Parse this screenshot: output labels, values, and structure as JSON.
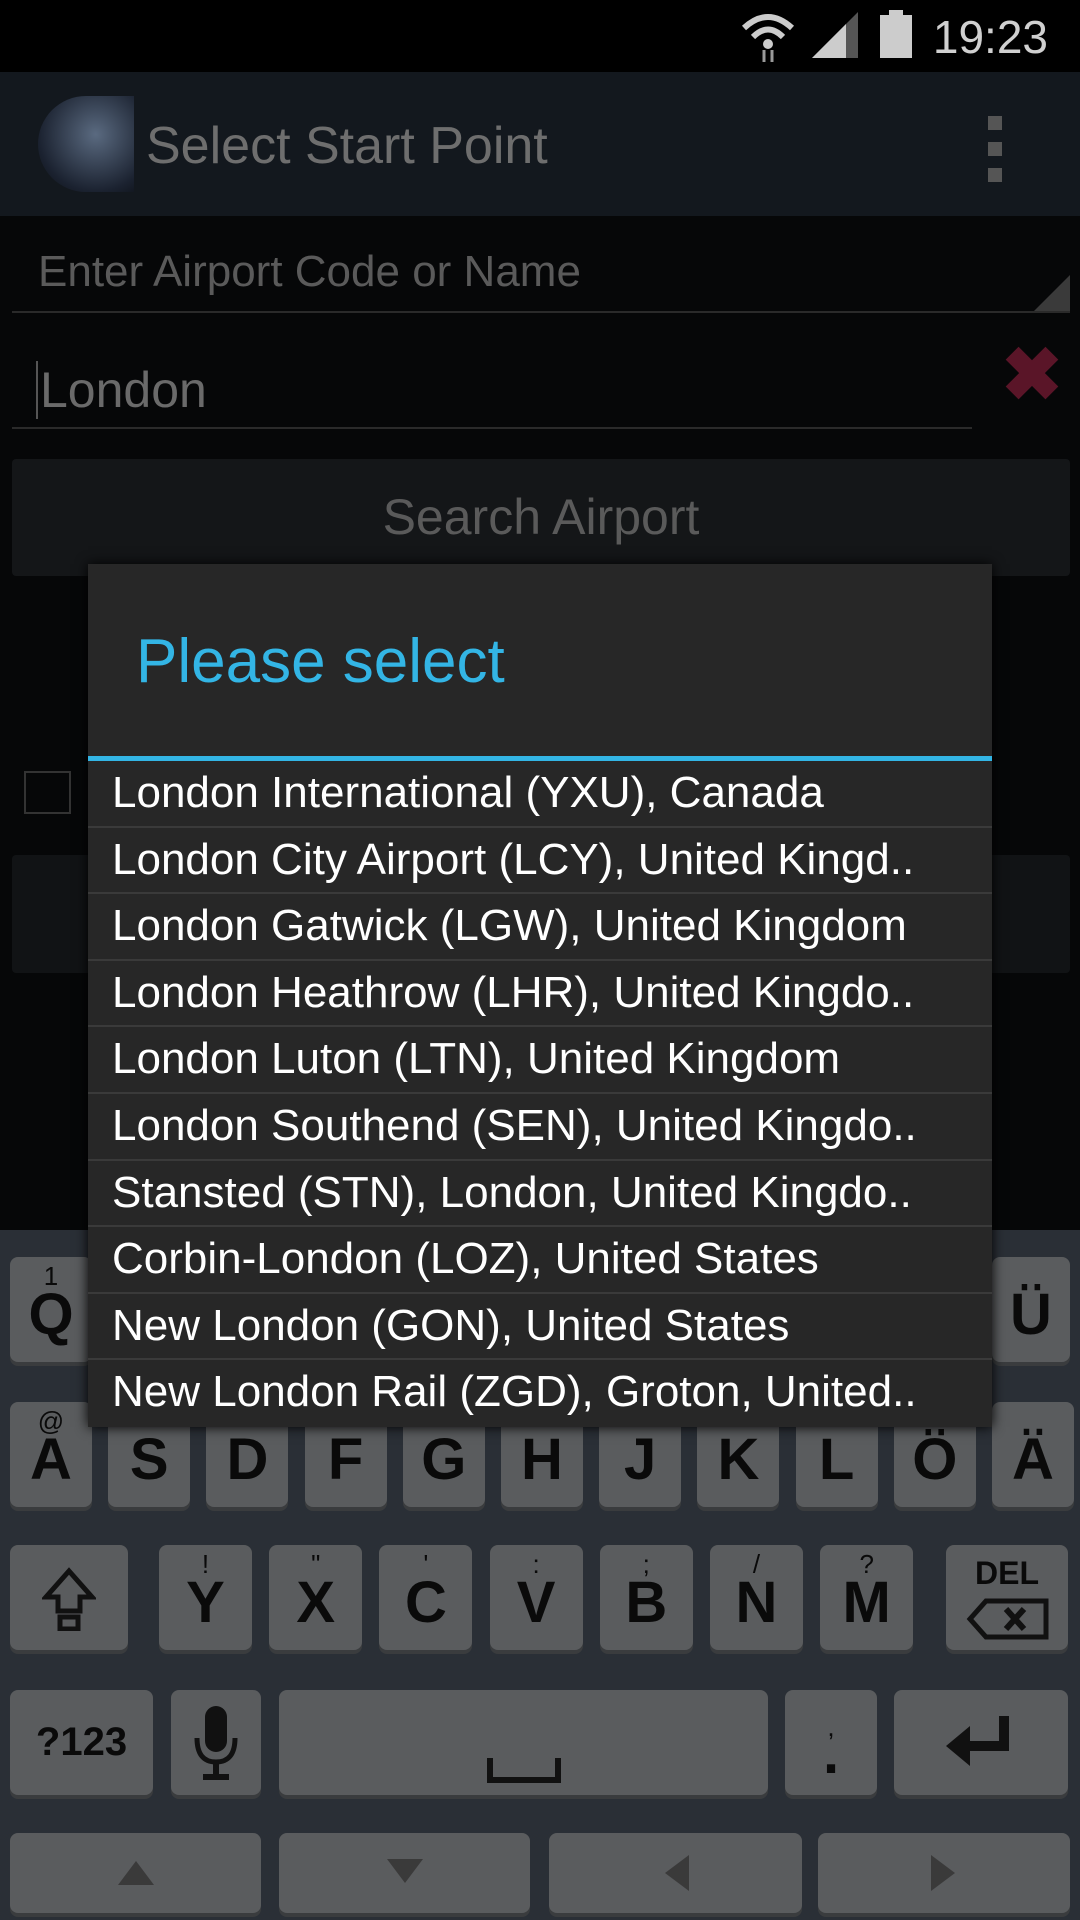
{
  "status_bar": {
    "time": "19:23",
    "icons": [
      "wifi-icon",
      "signal-icon",
      "battery-icon"
    ]
  },
  "action_bar": {
    "title": "Select Start Point",
    "overflow_icon": "more-vertical-icon"
  },
  "form": {
    "code_placeholder": "Enter Airport Code or Name",
    "name_value": "London",
    "clear_icon": "✖",
    "search_label": "Search Airport"
  },
  "dialog": {
    "title": "Please select",
    "accent": "#33B5E5",
    "items": [
      "London International (YXU), Canada",
      "London City Airport (LCY), United Kingd..",
      "London Gatwick (LGW), United Kingdom",
      "London Heathrow (LHR), United Kingdo..",
      "London Luton (LTN), United Kingdom",
      "London Southend (SEN), United Kingdo..",
      "Stansted (STN), London, United Kingdo..",
      "Corbin-London (LOZ), United States",
      "New London (GON), United States",
      "New London Rail (ZGD), Groton, United.."
    ]
  },
  "keyboard": {
    "row1": [
      {
        "main": "Q",
        "hint": "1"
      },
      {
        "main": "Ü",
        "hint": ""
      }
    ],
    "row2": [
      {
        "main": "A",
        "hint": "@"
      },
      {
        "main": "S"
      },
      {
        "main": "D"
      },
      {
        "main": "F"
      },
      {
        "main": "G"
      },
      {
        "main": "H"
      },
      {
        "main": "J"
      },
      {
        "main": "K"
      },
      {
        "main": "L"
      },
      {
        "main": "Ö"
      },
      {
        "main": "Ä"
      }
    ],
    "row3": [
      {
        "main": "Y",
        "hint": "!"
      },
      {
        "main": "X",
        "hint": "\""
      },
      {
        "main": "C",
        "hint": "'"
      },
      {
        "main": "V",
        "hint": ":"
      },
      {
        "main": "B",
        "hint": ";"
      },
      {
        "main": "N",
        "hint": "/"
      },
      {
        "main": "M",
        "hint": "?"
      }
    ],
    "del": "DEL",
    "sym": "?123",
    "punct_hint": ",",
    "punct": "."
  }
}
